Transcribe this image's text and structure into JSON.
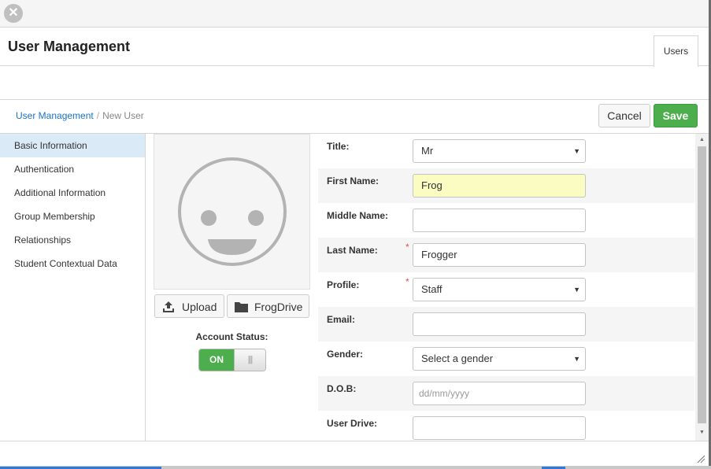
{
  "header": {
    "title": "User Management",
    "tab_label": "Users"
  },
  "breadcrumb": {
    "root": "User Management",
    "separator": "/",
    "current": "New User"
  },
  "actions": {
    "cancel_label": "Cancel",
    "save_label": "Save"
  },
  "sidebar": {
    "items": [
      {
        "label": "Basic Information",
        "active": true
      },
      {
        "label": "Authentication"
      },
      {
        "label": "Additional Information"
      },
      {
        "label": "Group Membership"
      },
      {
        "label": "Relationships"
      },
      {
        "label": "Student Contextual Data"
      }
    ]
  },
  "avatar": {
    "icon": "smiley-face-icon"
  },
  "buttons": {
    "upload_label": "Upload",
    "frogdrive_label": "FrogDrive"
  },
  "account_status": {
    "label": "Account Status:",
    "toggle_on": "ON",
    "toggle_handle": "|||"
  },
  "form": {
    "title": {
      "label": "Title:",
      "value": "Mr"
    },
    "first_name": {
      "label": "First Name:",
      "value": "Frog"
    },
    "middle_name": {
      "label": "Middle Name:",
      "value": ""
    },
    "last_name": {
      "label": "Last Name:",
      "value": "Frogger",
      "required_mark": "*"
    },
    "profile": {
      "label": "Profile:",
      "value": "Staff",
      "required_mark": "*"
    },
    "email": {
      "label": "Email:",
      "value": ""
    },
    "gender": {
      "label": "Gender:",
      "value": "Select a gender"
    },
    "dob": {
      "label": "D.O.B:",
      "placeholder": "dd/mm/yyyy"
    },
    "user_drive": {
      "label": "User Drive:",
      "value": ""
    }
  },
  "colors": {
    "accent_link": "#1a73c8",
    "save_green": "#4cae4c",
    "active_nav": "#dbeaf7",
    "highlight_field": "#fafcc2",
    "required": "#d9534f"
  }
}
